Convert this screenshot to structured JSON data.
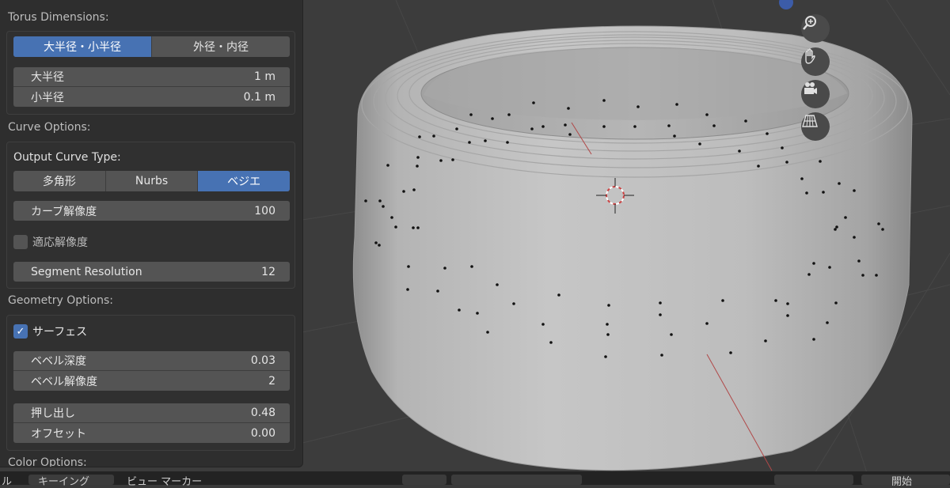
{
  "torus": {
    "title": "Torus Dimensions:",
    "mode_tabs": [
      "大半径・小半径",
      "外径・内径"
    ],
    "active_mode": 0,
    "major_label": "大半径",
    "major_value": "1 m",
    "minor_label": "小半径",
    "minor_value": "0.1 m"
  },
  "curve": {
    "title": "Curve Options:",
    "output_type_label": "Output Curve Type:",
    "types": [
      "多角形",
      "Nurbs",
      "ベジエ"
    ],
    "active_type": 2,
    "resolution_label": "カーブ解像度",
    "resolution_value": "100",
    "adaptive_label": "適応解像度",
    "adaptive_checked": false,
    "segment_label": "Segment Resolution",
    "segment_value": "12"
  },
  "geometry": {
    "title": "Geometry Options:",
    "surface_label": "サーフェス",
    "surface_checked": true,
    "bevel_depth_label": "ベベル深度",
    "bevel_depth_value": "0.03",
    "bevel_res_label": "ベベル解像度",
    "bevel_res_value": "2",
    "extrude_label": "押し出し",
    "extrude_value": "0.48",
    "offset_label": "オフセット",
    "offset_value": "0.00"
  },
  "color": {
    "title": "Color Options:"
  },
  "viewport": {
    "nav_icons": [
      "zoom-icon",
      "hand-pan-icon",
      "camera-icon",
      "grid-perspective-icon"
    ]
  },
  "bottombar": {
    "left_text": "ル",
    "mid_text": "キーイング",
    "right_text": "ビュー  マーカー",
    "far_right": "開始"
  },
  "colors": {
    "accent": "#4772b3",
    "panel": "#2e2e2e",
    "field": "#545454",
    "viewport": "#3c3c3c"
  }
}
